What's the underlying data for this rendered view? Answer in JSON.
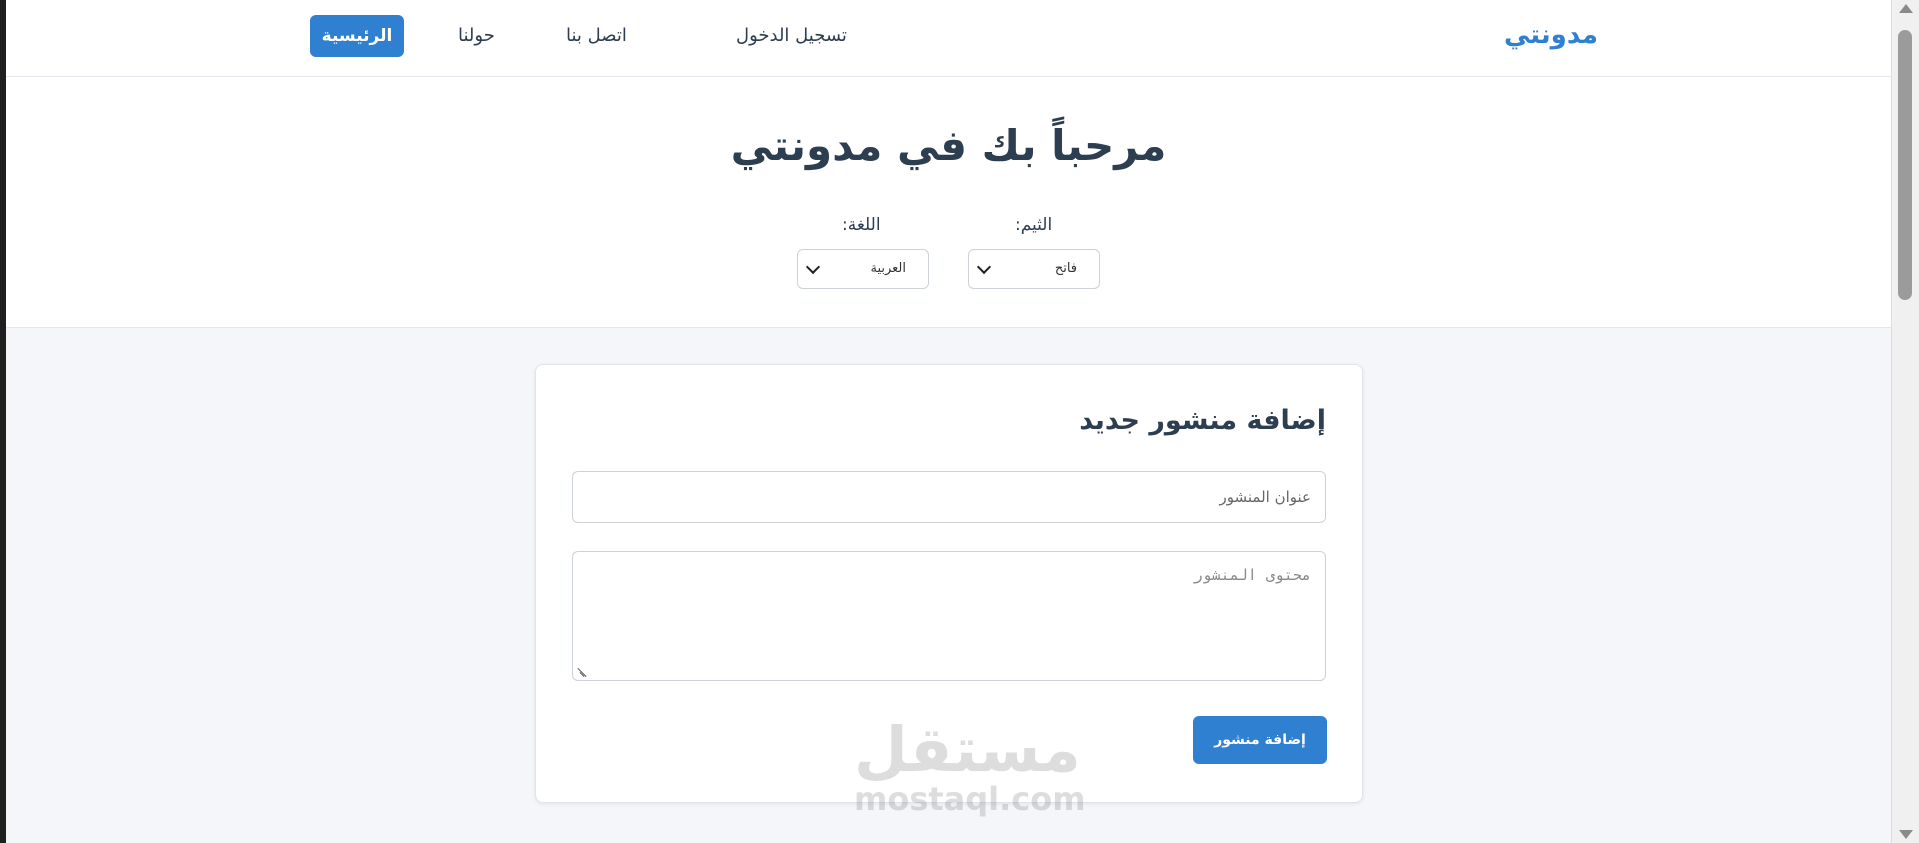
{
  "nav": {
    "brand": "مدونتي",
    "links": {
      "login": "تسجيل الدخول",
      "contact": "اتصل بنا",
      "about": "حولنا",
      "home": "الرئيسية"
    }
  },
  "hero": {
    "title": "مرحباً بك في مدونتي",
    "theme_label": "الثيم:",
    "theme_value": "فاتح",
    "language_label": "اللغة:",
    "language_value": "العربية"
  },
  "form": {
    "heading": "إضافة منشور جديد",
    "title_placeholder": "عنوان المنشور",
    "content_placeholder": "محتوى المنشور",
    "submit_label": "إضافة منشور"
  },
  "watermark": {
    "arabic": "مستقل",
    "latin": "mostaql.com"
  },
  "colors": {
    "accent": "#2f80d1",
    "text": "#2c3e50",
    "page_bg": "#f4f6fa"
  }
}
